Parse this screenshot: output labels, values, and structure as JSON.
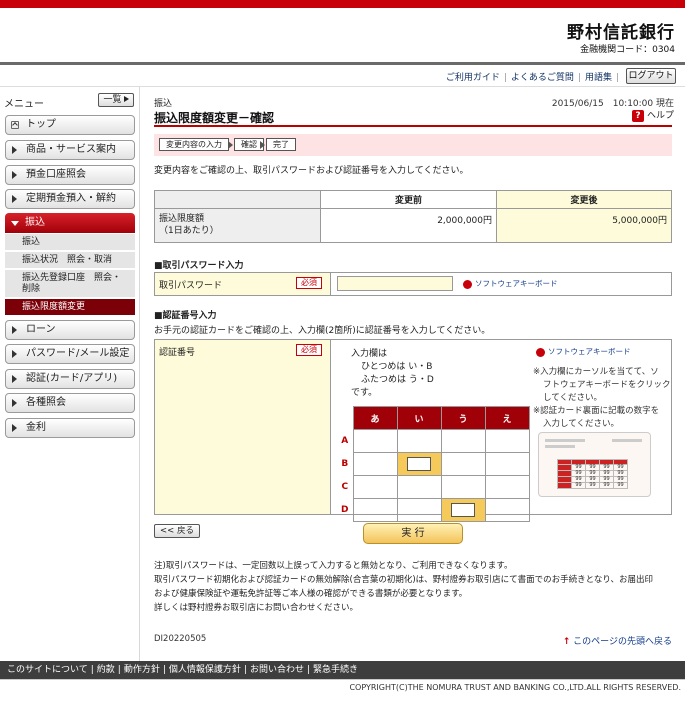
{
  "header": {
    "bank_name": "野村信託銀行",
    "bank_code": "金融機関コード：0304"
  },
  "util": {
    "links": [
      "ご利用ガイド",
      "よくあるご質問",
      "用語集"
    ],
    "logout": "ログアウト"
  },
  "sidebar": {
    "title": "メニュー",
    "list_button": "一覧",
    "items": [
      "トップ",
      "商品・サービス案内",
      "預金口座照会",
      "定期預金預入・解約"
    ],
    "active": "振込",
    "sub_items": [
      "振込",
      "振込状況　照会・取消",
      "振込先登録口座　照会・削除",
      "振込限度額変更"
    ],
    "items_after": [
      "ローン",
      "パスワード/メール設定",
      "認証(カード/アプリ)",
      "各種照会",
      "金利"
    ]
  },
  "main": {
    "breadcrumb": "振込",
    "date": "2015/06/15　10:10:00 現在",
    "title": "振込限度額変更－確認",
    "help": "ヘルプ",
    "steps": [
      "変更内容の入力",
      "確認",
      "完了"
    ],
    "intro": "変更内容をご確認の上、取引パスワードおよび認証番号を入力してください。",
    "table": {
      "col_before": "変更前",
      "col_after": "変更後",
      "row_label1": "振込限度額",
      "row_label2": "（1日あたり）",
      "before": "2,000,000円",
      "after": "5,000,000円"
    },
    "pw_section": "■取引パスワード入力",
    "pw_label": "取引パスワード",
    "required": "必須",
    "soft_kb": "ソフトウェアキーボード",
    "auth_section": "■認証番号入力",
    "auth_intro": "お手元の認証カードをご確認の上、入力欄(2箇所)に認証番号を入力してください。",
    "auth_label": "認証番号",
    "instr": [
      "入力欄は",
      "ひとつめは い・B",
      "ふたつめは う・D",
      "です。"
    ],
    "grid_cols": [
      "あ",
      "い",
      "う",
      "え"
    ],
    "grid_rows": [
      "A",
      "B",
      "C",
      "D"
    ],
    "note": [
      "※入力欄にカーソルを当てて、ソ",
      "フトウェアキーボードをクリック",
      "してください。",
      "※認証カード裏面に記載の数字を",
      "入力してください。"
    ],
    "card_value": "99",
    "back": "<< 戻る",
    "execute": "実 行",
    "notes": [
      "注)取引パスワードは、一定回数以上誤って入力すると無効となり、ご利用できなくなります。",
      "取引パスワード初期化および認証カードの無効解除(合言葉の初期化)は、野村證券お取引店にて書面でのお手続きとなり、お届出印",
      "および健康保険証や運転免許証等ご本人様の確認ができる書類が必要となります。",
      "詳しくは野村證券お取引店にお問い合わせください。"
    ],
    "page_id": "DI20220505",
    "page_top": "このページの先頭へ戻る"
  },
  "footer": {
    "links": [
      "このサイトについて",
      "約款",
      "動作方針",
      "個人情報保護方針",
      "お問い合わせ",
      "緊急手続き"
    ],
    "copyright": "COPYRIGHT(C)THE NOMURA TRUST AND BANKING CO.,LTD.ALL RIGHTS RESERVED."
  },
  "colors": {
    "brand": "#c8000a",
    "active_sub": "#7c0008",
    "input_bg": "#fdfbd9"
  }
}
